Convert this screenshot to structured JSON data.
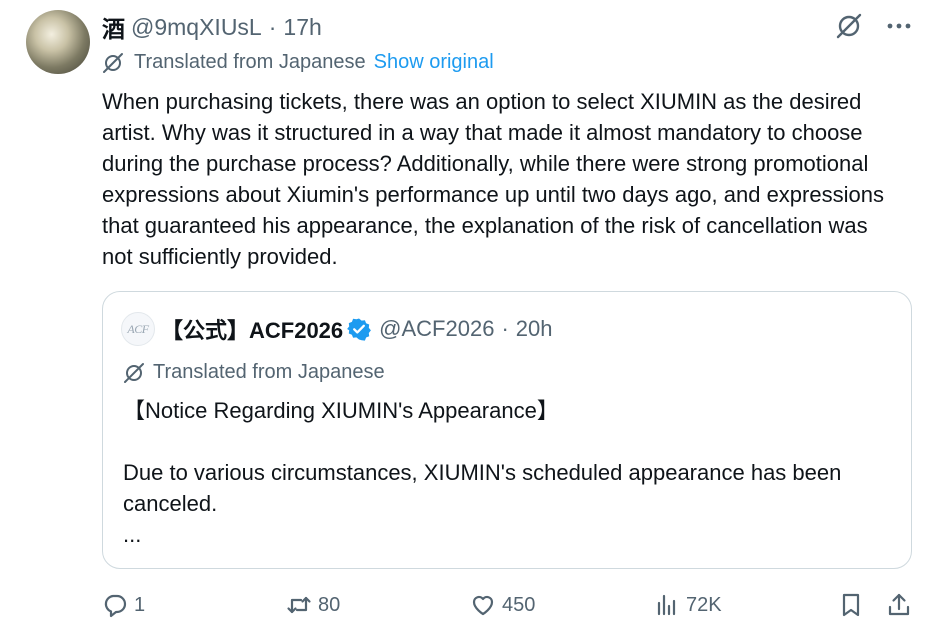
{
  "tweet": {
    "display_name": "酒",
    "handle": "@9mqXIUsL",
    "separator": "·",
    "time": "17h",
    "translated_label": "Translated from Japanese",
    "show_original": "Show original",
    "text": "When purchasing tickets, there was an option to select XIUMIN as the desired artist. Why was it structured in a way that made it almost mandatory to choose during the purchase process? Additionally, while there were strong promotional expressions about Xiumin's performance up until two days ago, and expressions that guaranteed his appearance, the explanation of the risk of cancellation was not sufficiently provided."
  },
  "quote": {
    "avatar_text": "ACF",
    "display_name": "【公式】ACF2026",
    "handle": "@ACF2026",
    "separator": "·",
    "time": "20h",
    "translated_label": "Translated from Japanese",
    "text": "【Notice Regarding XIUMIN's Appearance】\n\nDue to various circumstances, XIUMIN's scheduled appearance has been canceled.\n..."
  },
  "actions": {
    "replies": "1",
    "reposts": "80",
    "likes": "450",
    "views": "72K"
  },
  "icons": {
    "top_right": [
      "grok-icon",
      "more-icon"
    ],
    "translate": "translate-icon",
    "verified": "verified-badge-icon",
    "action_bar": [
      "reply-icon",
      "repost-icon",
      "like-icon",
      "views-icon",
      "bookmark-icon",
      "share-icon"
    ]
  },
  "colors": {
    "text": "#0f1419",
    "muted": "#536471",
    "link": "#1d9bf0",
    "border": "#cfd9de",
    "verified": "#1d9bf0"
  }
}
